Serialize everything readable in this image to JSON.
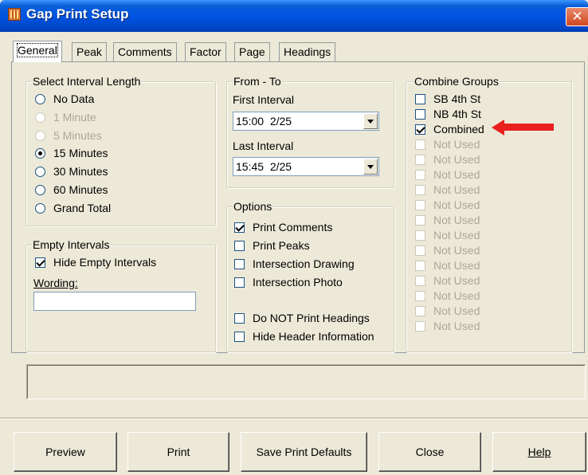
{
  "window": {
    "title": "Gap Print Setup",
    "close_glyph": "✕"
  },
  "tabs": [
    "General",
    "Peak",
    "Comments",
    "Factor",
    "Page",
    "Headings"
  ],
  "interval_group": {
    "title": "Select Interval Length",
    "options": [
      {
        "label": "No Data",
        "enabled": true,
        "selected": false
      },
      {
        "label": "1 Minute",
        "enabled": false,
        "selected": false
      },
      {
        "label": "5 Minutes",
        "enabled": false,
        "selected": false
      },
      {
        "label": "15 Minutes",
        "enabled": true,
        "selected": true
      },
      {
        "label": "30 Minutes",
        "enabled": true,
        "selected": false
      },
      {
        "label": "60 Minutes",
        "enabled": true,
        "selected": false
      },
      {
        "label": "Grand Total",
        "enabled": true,
        "selected": false
      }
    ]
  },
  "empty_group": {
    "title": "Empty Intervals",
    "hide_label": "Hide Empty Intervals",
    "hide_checked": true,
    "wording_label": "Wording:",
    "wording_value": ""
  },
  "from_to": {
    "title": "From - To",
    "first_label": "First Interval",
    "first_value": "15:00  2/25",
    "last_label": "Last Interval",
    "last_value": "15:45  2/25"
  },
  "options_group": {
    "title": "Options",
    "items": [
      {
        "label": "Print Comments",
        "checked": true
      },
      {
        "label": "Print Peaks",
        "checked": false
      },
      {
        "label": "Intersection Drawing",
        "checked": false
      },
      {
        "label": "Intersection Photo",
        "checked": false
      },
      {
        "label": "Do NOT Print Headings",
        "checked": false
      },
      {
        "label": "Hide Header Information",
        "checked": false
      }
    ]
  },
  "combine_group": {
    "title": "Combine Groups",
    "items": [
      {
        "label": "SB 4th St",
        "enabled": true,
        "checked": false
      },
      {
        "label": "NB 4th St",
        "enabled": true,
        "checked": false
      },
      {
        "label": "Combined",
        "enabled": true,
        "checked": true
      },
      {
        "label": "Not Used",
        "enabled": false,
        "checked": false
      },
      {
        "label": "Not Used",
        "enabled": false,
        "checked": false
      },
      {
        "label": "Not Used",
        "enabled": false,
        "checked": false
      },
      {
        "label": "Not Used",
        "enabled": false,
        "checked": false
      },
      {
        "label": "Not Used",
        "enabled": false,
        "checked": false
      },
      {
        "label": "Not Used",
        "enabled": false,
        "checked": false
      },
      {
        "label": "Not Used",
        "enabled": false,
        "checked": false
      },
      {
        "label": "Not Used",
        "enabled": false,
        "checked": false
      },
      {
        "label": "Not Used",
        "enabled": false,
        "checked": false
      },
      {
        "label": "Not Used",
        "enabled": false,
        "checked": false
      },
      {
        "label": "Not Used",
        "enabled": false,
        "checked": false
      },
      {
        "label": "Not Used",
        "enabled": false,
        "checked": false
      },
      {
        "label": "Not Used",
        "enabled": false,
        "checked": false
      }
    ]
  },
  "status_text": "",
  "buttons": {
    "preview": "Preview",
    "print": "Print",
    "save_defaults": "Save Print Defaults",
    "close": "Close",
    "help": "Help"
  },
  "colors": {
    "titlebar": "#0054e3",
    "annotation_arrow": "#e8201e",
    "dialog_bg": "#ece9d8"
  },
  "icons": {
    "app": "gap-app-icon",
    "annotation": "red-arrow-icon"
  }
}
